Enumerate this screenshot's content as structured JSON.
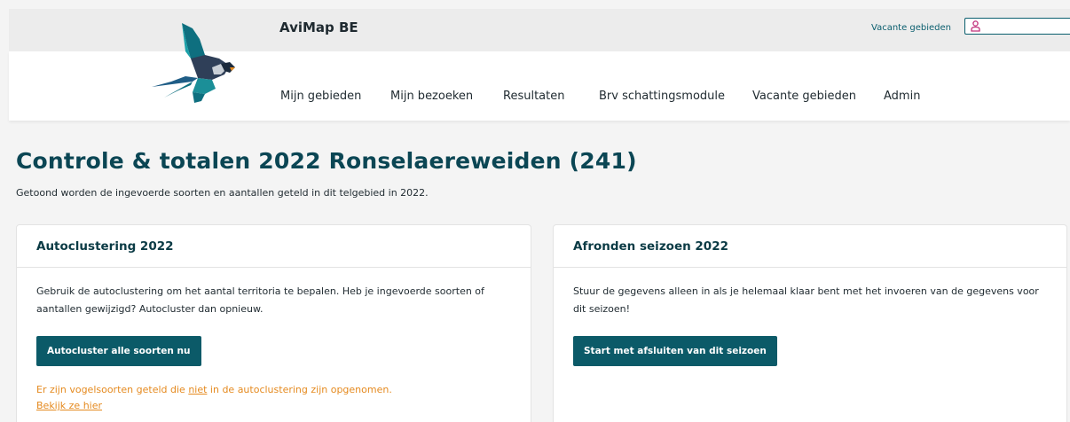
{
  "app": {
    "title": "AviMap BE",
    "top_link": "Vacante gebieden",
    "user_field_value": ""
  },
  "nav": [
    {
      "label": "Mijn gebieden"
    },
    {
      "label": "Mijn bezoeken"
    },
    {
      "label": "Resultaten"
    },
    {
      "label": "Brv schattingsmodule"
    },
    {
      "label": "Vacante gebieden"
    },
    {
      "label": "Admin"
    }
  ],
  "page": {
    "title": "Controle & totalen 2022 Ronselaereweiden (241)",
    "subtitle": "Getoond worden de ingevoerde soorten en aantallen geteld in dit telgebied in 2022."
  },
  "cards": {
    "autoclustering": {
      "title": "Autoclustering 2022",
      "text": "Gebruik de autoclustering om het aantal territoria te bepalen. Heb je ingevoerde soorten of aantallen gewijzigd? Autocluster dan opnieuw.",
      "button": "Autocluster alle soorten nu",
      "warning_prefix": "Er zijn vogelsoorten geteld die ",
      "warning_link": "niet",
      "warning_suffix": " in de autoclustering zijn opgenomen.",
      "warning_action": "Bekijk ze hier"
    },
    "afronden": {
      "title": "Afronden seizoen 2022",
      "text": "Stuur de gegevens alleen in als je helemaal klaar bent met het invoeren van de gegevens voor dit seizoen!",
      "button": "Start met afsluiten van dit seizoen"
    }
  },
  "colors": {
    "accent": "#0b5a68",
    "title": "#0b4654",
    "warning": "#e58a1f",
    "user_icon": "#c0307a"
  },
  "icons": {
    "logo": "swallow-logo",
    "user": "user-icon"
  }
}
